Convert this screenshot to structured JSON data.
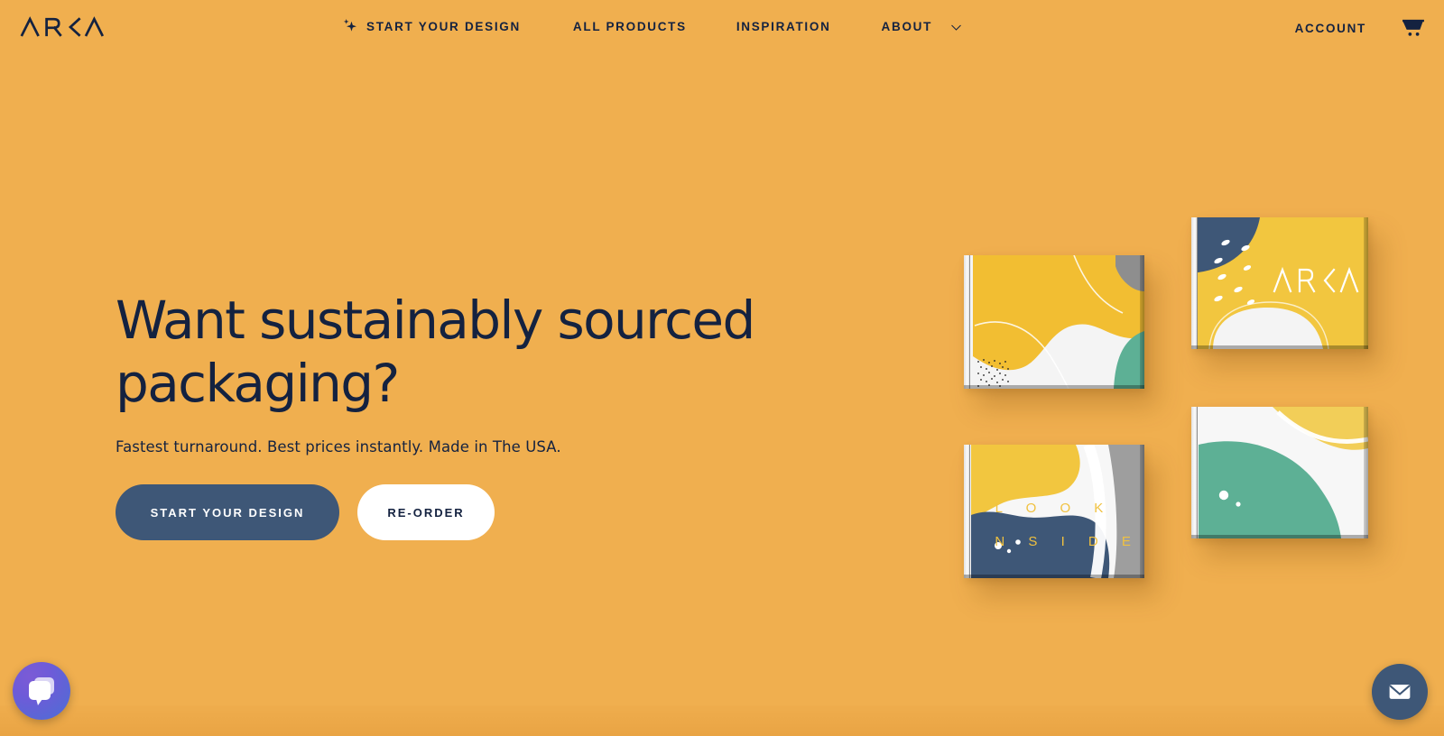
{
  "brand": {
    "name": "ARKA",
    "logo_icon": "arka-wordmark-logo"
  },
  "header": {
    "nav": [
      {
        "label": "START YOUR DESIGN",
        "icon": "sparkle-icon"
      },
      {
        "label": "ALL PRODUCTS",
        "icon": ""
      },
      {
        "label": "INSPIRATION",
        "icon": ""
      },
      {
        "label": "ABOUT",
        "icon": "chevron-down-icon"
      }
    ],
    "account_label": "ACCOUNT",
    "cart_icon": "shopping-cart-icon"
  },
  "hero": {
    "headline_line1": "Want sustainably sourced",
    "headline_line2": "packaging?",
    "subhead": "Fastest turnaround. Best prices instantly. Made in The USA.",
    "primary_cta": "START YOUR DESIGN",
    "secondary_cta": "RE-ORDER"
  },
  "boxes": [
    {
      "name": "mailer-box-yellow-teal",
      "caption": ""
    },
    {
      "name": "mailer-box-arka-branded",
      "caption": "ARKA"
    },
    {
      "name": "mailer-box-look-inside",
      "caption_line1": "L O O K",
      "caption_line2": "I N S I D E"
    },
    {
      "name": "mailer-box-teal-wave",
      "caption": ""
    }
  ],
  "widgets": {
    "chat_icon": "chat-bubble-icon",
    "mail_icon": "envelope-icon"
  },
  "colors": {
    "background": "#F0AF4F",
    "navy": "#142240",
    "slate": "#3E5777",
    "yellow": "#F2C23C",
    "teal": "#5DB095",
    "white": "#FFFFFF",
    "gray": "#8E8E8E"
  }
}
